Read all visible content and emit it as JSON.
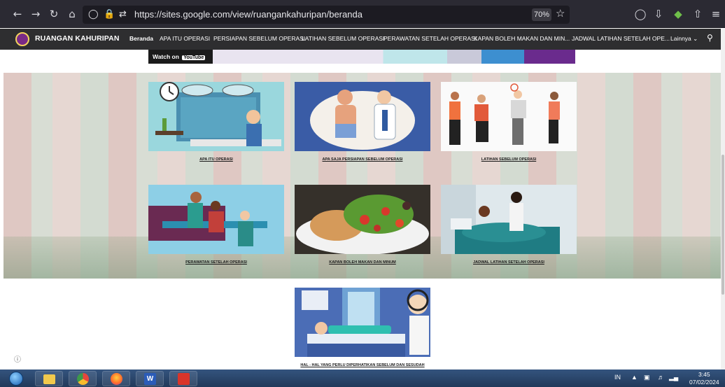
{
  "browser": {
    "url": "https://sites.google.com/view/ruangankahuripan/beranda",
    "zoom": "70%",
    "icons": [
      "back-icon",
      "forward-icon",
      "reload-icon",
      "home-icon",
      "shield-icon",
      "lock-icon",
      "permissions-icon",
      "bookmark-star-icon",
      "pocket-icon",
      "download-icon",
      "extension-icon",
      "share-icon",
      "menu-icon"
    ]
  },
  "site": {
    "name": "RUANGAN KAHURIPAN",
    "nav": [
      {
        "label": "Beranda",
        "active": true
      },
      {
        "label": "APA ITU OPERASI"
      },
      {
        "label": "PERSIAPAN SEBELUM OPERASI"
      },
      {
        "label": "LATIHAN SEBELUM OPERASI"
      },
      {
        "label": "PERAWATAN SETELAH OPERASI"
      },
      {
        "label": "KAPAN BOLEH MAKAN DAN MIN..."
      },
      {
        "label": "JADWAL LATIHAN SETELAH OPE..."
      },
      {
        "label": "Lainnya"
      }
    ],
    "more_chevron": "⌄"
  },
  "video": {
    "watch_on": "Watch on",
    "youtube": "YouTube"
  },
  "cards": [
    {
      "caption": "APA ITU OPERASI",
      "icon": "operating-room-illustration"
    },
    {
      "caption": "APA SAJA PERSIAPAN SEBELUM OPERASI",
      "icon": "doctor-consultation-illustration"
    },
    {
      "caption": "LATIHAN SEBELUM OPERASI",
      "icon": "stretching-exercise-illustration"
    },
    {
      "caption": "PERAWATAN SETELAH OPERASI",
      "icon": "physiotherapy-illustration"
    },
    {
      "caption": "KAPAN BOLEH MAKAN DAN MINUM",
      "icon": "salad-food-photo"
    },
    {
      "caption": "JADWAL LATIHAN SETELAH OPERASI",
      "icon": "patient-in-bed-photo"
    },
    {
      "caption": "HAL - HAL YANG PERLU DIPERHATIKAN SEBELUM DAN SESUDAH",
      "icon": "patient-bed-doctor-illustration"
    }
  ],
  "info_icon": "ⓘ",
  "taskbar": {
    "apps": [
      "windows-start-icon",
      "file-explorer-icon",
      "chrome-icon",
      "firefox-icon",
      "word-icon",
      "adobe-reader-icon"
    ],
    "lang": "IN",
    "time": "3:45",
    "date": "07/02/2024"
  }
}
